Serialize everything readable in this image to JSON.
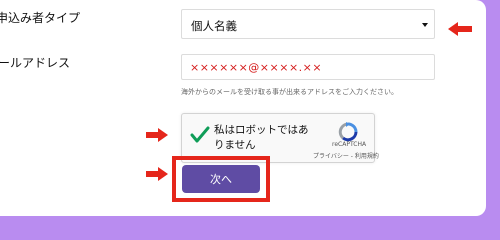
{
  "form": {
    "applicant_type_label": "申込み者タイプ",
    "applicant_type_value": "個人名義",
    "email_label": "ールアドレス",
    "email_value": "××××××@××××.××",
    "email_note": "海外からのメールを受け取る事が出来るアドレスをご入力ください。"
  },
  "recaptcha": {
    "label": "私はロボットではありません",
    "brand": "reCAPTCHA",
    "links": "プライバシー - 利用規約"
  },
  "next_button": {
    "label": "次へ"
  },
  "icons": {
    "arrows": "arrow-icon",
    "check": "checkmark-icon",
    "recaptcha_logo": "recaptcha-logo-icon"
  },
  "colors": {
    "background": "#b98cf0",
    "arrow": "#e5261b",
    "button": "#5f4ca4",
    "highlight_border": "#e5261b",
    "email_text": "#d41a1a"
  }
}
